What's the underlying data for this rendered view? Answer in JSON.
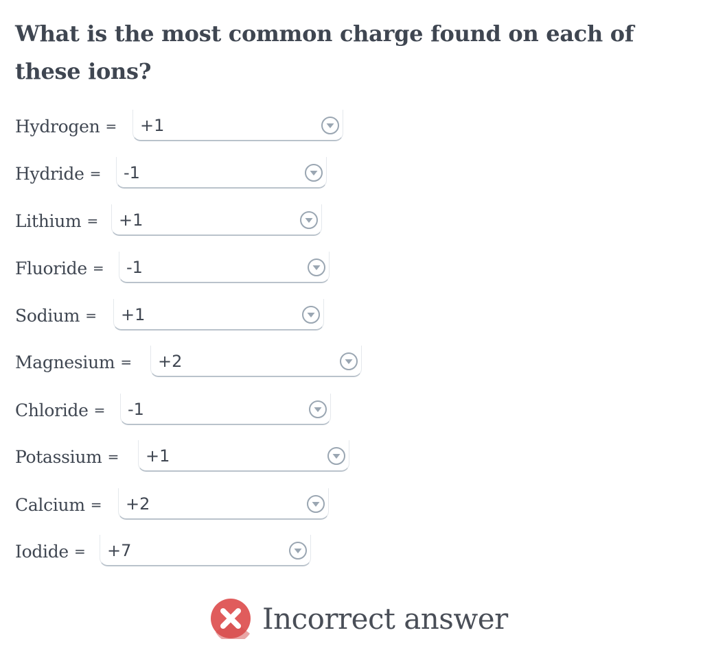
{
  "question": "What is the most common charge found on each of these ions?",
  "equals_sign": "=",
  "rows": [
    {
      "label": "Hydrogen",
      "value": "+1"
    },
    {
      "label": "Hydride",
      "value": "-1"
    },
    {
      "label": "Lithium",
      "value": "+1"
    },
    {
      "label": "Fluoride",
      "value": "-1"
    },
    {
      "label": "Sodium",
      "value": "+1"
    },
    {
      "label": "Magnesium",
      "value": "+2"
    },
    {
      "label": "Chloride",
      "value": "-1"
    },
    {
      "label": "Potassium",
      "value": "+1"
    },
    {
      "label": "Calcium",
      "value": "+2"
    },
    {
      "label": "Iodide",
      "value": "+7"
    }
  ],
  "dropdown_icon": "chevron-down-circle-icon",
  "feedback": {
    "icon": "incorrect-x-icon",
    "icon_color": "#e05c5c",
    "message": "Incorrect answer"
  },
  "colors": {
    "text": "#3f4651",
    "select_border": "#b9c2cb",
    "arrow": "#9aa6b2"
  }
}
